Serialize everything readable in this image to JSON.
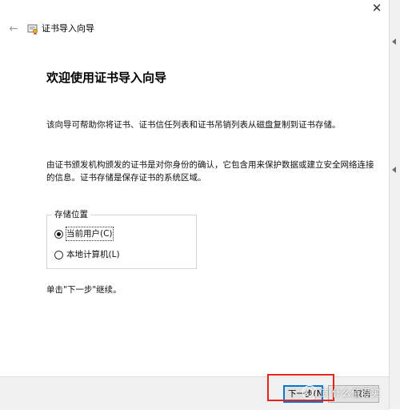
{
  "window": {
    "title": "证书导入向导",
    "close_glyph": "✕",
    "back_glyph": "←"
  },
  "main": {
    "heading": "欢迎使用证书导入向导",
    "intro": "该向导可帮助你将证书、证书信任列表和证书吊销列表从磁盘复制到证书存储。",
    "description": "由证书颁发机构颁发的证书是对你身份的确认，它包含用来保护数据或建立安全网络连接的信息。证书存储是保存证书的系统区域。",
    "store_location": {
      "label": "存储位置",
      "options": [
        {
          "label": "当前用户(C)",
          "selected": true
        },
        {
          "label": "本地计算机(L)",
          "selected": false
        }
      ]
    },
    "continue_hint": "单击\"下一步\"继续。"
  },
  "footer": {
    "next_label": "下一步(N)",
    "cancel_label": "取消"
  },
  "watermark": {
    "text": "值 什么值得买"
  },
  "colors": {
    "highlight": "#e8231c",
    "focus_border": "#0078d7",
    "footer_bg": "#f0f0f0"
  }
}
